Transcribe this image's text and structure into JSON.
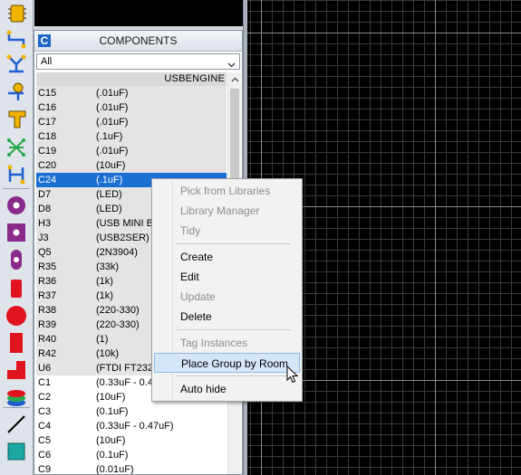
{
  "toolbar": {
    "tools": [
      {
        "icon": "component-chip-icon",
        "color": "#f0b400"
      },
      {
        "icon": "track-route-icon",
        "color": "#1f5fd0"
      },
      {
        "icon": "bus-route-icon",
        "color": "#1f5fd0"
      },
      {
        "icon": "junction-dot-icon",
        "color": "#f0b400"
      },
      {
        "icon": "terminal-icon",
        "color": "#f0b400"
      },
      {
        "icon": "ratsnest-icon",
        "color": "#2aa84a"
      },
      {
        "icon": "connection-icon",
        "color": "#1f5fd0"
      },
      {
        "icon": "round-pad-icon",
        "color": "#8a2a8a"
      },
      {
        "icon": "square-pad-icon",
        "color": "#8a2a8a"
      },
      {
        "icon": "oval-pad-icon",
        "color": "#8a2a8a"
      },
      {
        "icon": "smt-pad-icon",
        "color": "#e0141e"
      },
      {
        "icon": "circle-shape-icon",
        "color": "#e0141e"
      },
      {
        "icon": "rectangle-shape-icon",
        "color": "#e0141e"
      },
      {
        "icon": "polygon-shape-icon",
        "color": "#e0141e"
      },
      {
        "icon": "layer-stack-icon",
        "color": "#e0141e"
      },
      {
        "icon": "line-draw-icon",
        "color": "#000000"
      },
      {
        "icon": "box-shape-icon",
        "color": "#1aa8a0"
      }
    ]
  },
  "panel": {
    "badge": "C",
    "title": "COMPONENTS",
    "filter": {
      "value": "All"
    },
    "group_label": "USBENGINE",
    "rows": [
      {
        "ref": "C15",
        "value": "(.01uF)",
        "shade": "grey"
      },
      {
        "ref": "C16",
        "value": "(.01uF)",
        "shade": "grey"
      },
      {
        "ref": "C17",
        "value": "(.01uF)",
        "shade": "grey"
      },
      {
        "ref": "C18",
        "value": "(.1uF)",
        "shade": "grey"
      },
      {
        "ref": "C19",
        "value": "(.01uF)",
        "shade": "grey"
      },
      {
        "ref": "C20",
        "value": "(10uF)",
        "shade": "grey"
      },
      {
        "ref": "C24",
        "value": "(.1uF)",
        "shade": "sel"
      },
      {
        "ref": "D7",
        "value": "(LED)",
        "shade": "grey"
      },
      {
        "ref": "D8",
        "value": "(LED)",
        "shade": "grey"
      },
      {
        "ref": "H3",
        "value": "(USB MINI B",
        "shade": "grey"
      },
      {
        "ref": "J3",
        "value": "(USB2SER)",
        "shade": "grey"
      },
      {
        "ref": "Q5",
        "value": "(2N3904)",
        "shade": "grey"
      },
      {
        "ref": "R35",
        "value": "(33k)",
        "shade": "grey"
      },
      {
        "ref": "R36",
        "value": "(1k)",
        "shade": "grey"
      },
      {
        "ref": "R37",
        "value": "(1k)",
        "shade": "grey"
      },
      {
        "ref": "R38",
        "value": "(220-330)",
        "shade": "grey"
      },
      {
        "ref": "R39",
        "value": "(220-330)",
        "shade": "grey"
      },
      {
        "ref": "R40",
        "value": "(1)",
        "shade": "grey"
      },
      {
        "ref": "R42",
        "value": "(10k)",
        "shade": "grey"
      },
      {
        "ref": "U6",
        "value": "(FTDI FT232",
        "shade": "grey"
      },
      {
        "ref": "C1",
        "value": "(0.33uF - 0.4",
        "shade": "white"
      },
      {
        "ref": "C2",
        "value": "(10uF)",
        "shade": "white"
      },
      {
        "ref": "C3",
        "value": "(0.1uF)",
        "shade": "white"
      },
      {
        "ref": "C4",
        "value": "(0.33uF - 0.47uF)",
        "shade": "white"
      },
      {
        "ref": "C5",
        "value": "(10uF)",
        "shade": "white"
      },
      {
        "ref": "C6",
        "value": "(0.1uF)",
        "shade": "white"
      },
      {
        "ref": "C9",
        "value": "(0.01uF)",
        "shade": "white"
      }
    ]
  },
  "context_menu": {
    "items": [
      {
        "label": "Pick from Libraries",
        "enabled": false
      },
      {
        "label": "Library Manager",
        "enabled": false
      },
      {
        "label": "Tidy",
        "enabled": false
      },
      {
        "separator": true
      },
      {
        "label": "Create",
        "enabled": true
      },
      {
        "label": "Edit",
        "enabled": true
      },
      {
        "label": "Update",
        "enabled": false
      },
      {
        "label": "Delete",
        "enabled": true
      },
      {
        "separator": true
      },
      {
        "label": "Tag Instances",
        "enabled": false
      },
      {
        "label": "Place Group by Room",
        "enabled": true,
        "hover": true
      },
      {
        "separator": true
      },
      {
        "label": "Auto hide",
        "enabled": true
      }
    ]
  },
  "colors": {
    "selection": "#1b6fd3",
    "canvas": "#000000",
    "grid": "#3a3a3a",
    "menu_hover": "#d5e6f8"
  }
}
